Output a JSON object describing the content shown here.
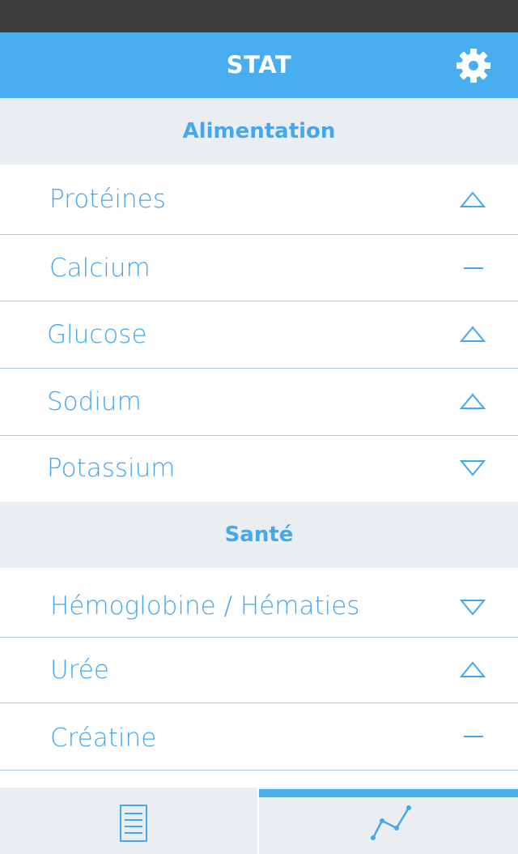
{
  "header": {
    "title": "STAT"
  },
  "sections": [
    {
      "title": "Alimentation",
      "items": [
        {
          "label": "Protéines",
          "trend": "up"
        },
        {
          "label": "Calcium",
          "trend": "flat"
        },
        {
          "label": "Glucose",
          "trend": "up"
        },
        {
          "label": "Sodium",
          "trend": "up"
        },
        {
          "label": "Potassium",
          "trend": "down"
        }
      ]
    },
    {
      "title": "Santé",
      "items": [
        {
          "label": "Hémoglobine / Hématies",
          "trend": "down"
        },
        {
          "label": "Urée",
          "trend": "up"
        },
        {
          "label": "Créatine",
          "trend": "flat"
        }
      ]
    }
  ],
  "tab_bar": {
    "tabs": [
      {
        "icon": "document-list-icon",
        "active": false
      },
      {
        "icon": "line-chart-icon",
        "active": true
      }
    ]
  },
  "colors": {
    "accent": "#48aef0",
    "text_blue": "#43a8ec",
    "section_bg": "#eaeef0",
    "status_bar": "#3d3d3d",
    "divider": "#a6cfe8"
  }
}
